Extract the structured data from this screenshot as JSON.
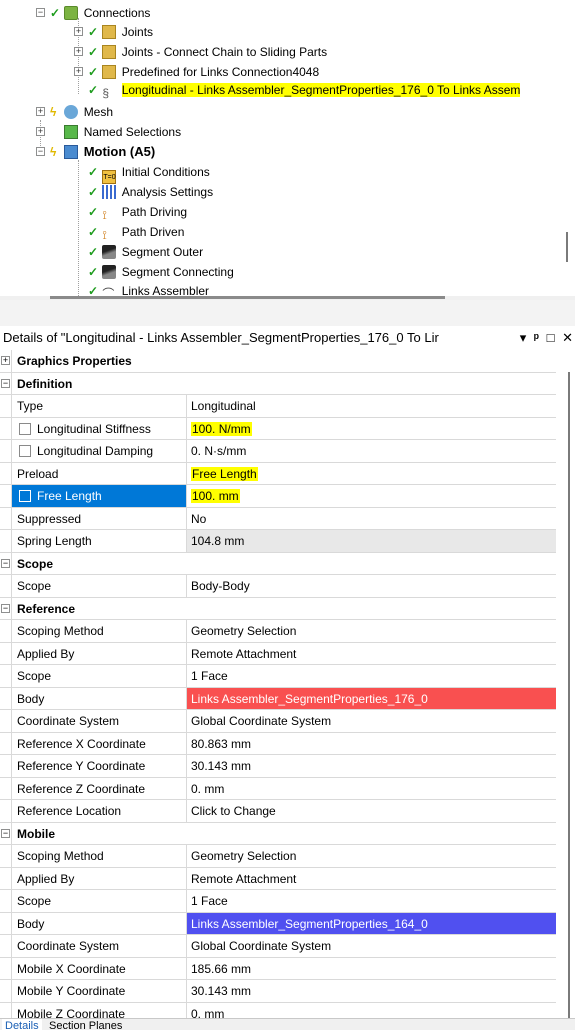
{
  "tree": {
    "items": [
      {
        "label": "Connections",
        "indent": 0
      },
      {
        "label": "Joints",
        "indent": 1
      },
      {
        "label": "Joints - Connect Chain to Sliding Parts",
        "indent": 1
      },
      {
        "label": "Predefined for Links Connection4048",
        "indent": 1
      },
      {
        "label": "Longitudinal - Links Assembler_SegmentProperties_176_0 To Links Assem",
        "indent": 1,
        "highlight": true
      },
      {
        "label": "Mesh",
        "indent": -1
      },
      {
        "label": "Named Selections",
        "indent": -1
      },
      {
        "label": "Motion (A5)",
        "indent": -1,
        "bold": true
      },
      {
        "label": "Initial Conditions",
        "indent": 0
      },
      {
        "label": "Analysis Settings",
        "indent": 0
      },
      {
        "label": "Path Driving",
        "indent": 0
      },
      {
        "label": "Path Driven",
        "indent": 0
      },
      {
        "label": "Segment Outer",
        "indent": 0
      },
      {
        "label": "Segment Connecting",
        "indent": 0
      },
      {
        "label": "Links Assembler",
        "indent": 0
      }
    ]
  },
  "details": {
    "title": "Details of \"Longitudinal - Links Assembler_SegmentProperties_176_0 To Lir",
    "menu_glyph": "▾",
    "pin_glyph": "ᵖ",
    "restore_glyph": "□",
    "close_glyph": "✕"
  },
  "grid": {
    "rows": [
      {
        "type": "cat",
        "label": "Graphics Properties",
        "expander": "+"
      },
      {
        "type": "cat",
        "label": "Definition",
        "expander": "−"
      },
      {
        "type": "row",
        "label": "Type",
        "value": "Longitudinal"
      },
      {
        "type": "row",
        "label": "Longitudinal Stiffness",
        "value": "100. N/mm",
        "checkbox": true,
        "style": "yellow"
      },
      {
        "type": "row",
        "label": "Longitudinal Damping",
        "value": "0. N·s/mm",
        "checkbox": true
      },
      {
        "type": "row",
        "label": "Preload",
        "value": "Free Length",
        "style": "yellow"
      },
      {
        "type": "row",
        "label": "Free Length",
        "value": "100. mm",
        "checkbox": true,
        "selected": true,
        "style": "yellow"
      },
      {
        "type": "row",
        "label": "Suppressed",
        "value": "No"
      },
      {
        "type": "row",
        "label": "Spring Length",
        "value": "104.8 mm",
        "style": "gray"
      },
      {
        "type": "cat",
        "label": "Scope",
        "expander": "−"
      },
      {
        "type": "row",
        "label": "Scope",
        "value": "Body-Body"
      },
      {
        "type": "cat",
        "label": "Reference",
        "expander": "−"
      },
      {
        "type": "row",
        "label": "Scoping Method",
        "value": "Geometry Selection"
      },
      {
        "type": "row",
        "label": "Applied By",
        "value": "Remote Attachment"
      },
      {
        "type": "row",
        "label": "Scope",
        "value": "1 Face"
      },
      {
        "type": "row",
        "label": "Body",
        "value": "Links Assembler_SegmentProperties_176_0",
        "style": "red"
      },
      {
        "type": "row",
        "label": "Coordinate System",
        "value": "Global Coordinate System"
      },
      {
        "type": "row",
        "label": "Reference X Coordinate",
        "value": "80.863 mm"
      },
      {
        "type": "row",
        "label": "Reference Y Coordinate",
        "value": "30.143 mm"
      },
      {
        "type": "row",
        "label": "Reference Z Coordinate",
        "value": "0. mm"
      },
      {
        "type": "row",
        "label": "Reference Location",
        "value": "Click to Change"
      },
      {
        "type": "cat",
        "label": "Mobile",
        "expander": "−"
      },
      {
        "type": "row",
        "label": "Scoping Method",
        "value": "Geometry Selection"
      },
      {
        "type": "row",
        "label": "Applied By",
        "value": "Remote Attachment"
      },
      {
        "type": "row",
        "label": "Scope",
        "value": "1 Face"
      },
      {
        "type": "row",
        "label": "Body",
        "value": "Links Assembler_SegmentProperties_164_0",
        "style": "blue"
      },
      {
        "type": "row",
        "label": "Coordinate System",
        "value": "Global Coordinate System"
      },
      {
        "type": "row",
        "label": "Mobile X Coordinate",
        "value": "185.66 mm"
      },
      {
        "type": "row",
        "label": "Mobile Y Coordinate",
        "value": "30.143 mm"
      },
      {
        "type": "row",
        "label": "Mobile Z Coordinate",
        "value": "0. mm"
      }
    ]
  },
  "tabs": {
    "items": [
      {
        "label": "Details",
        "active": true
      },
      {
        "label": "Section Planes",
        "active": false
      }
    ]
  },
  "colors": {
    "highlight_yellow": "#ffff00",
    "reference_body": "#f95050",
    "mobile_body": "#5050f0",
    "selected_row": "#0078d7",
    "check_green": "#1e9c1e"
  }
}
